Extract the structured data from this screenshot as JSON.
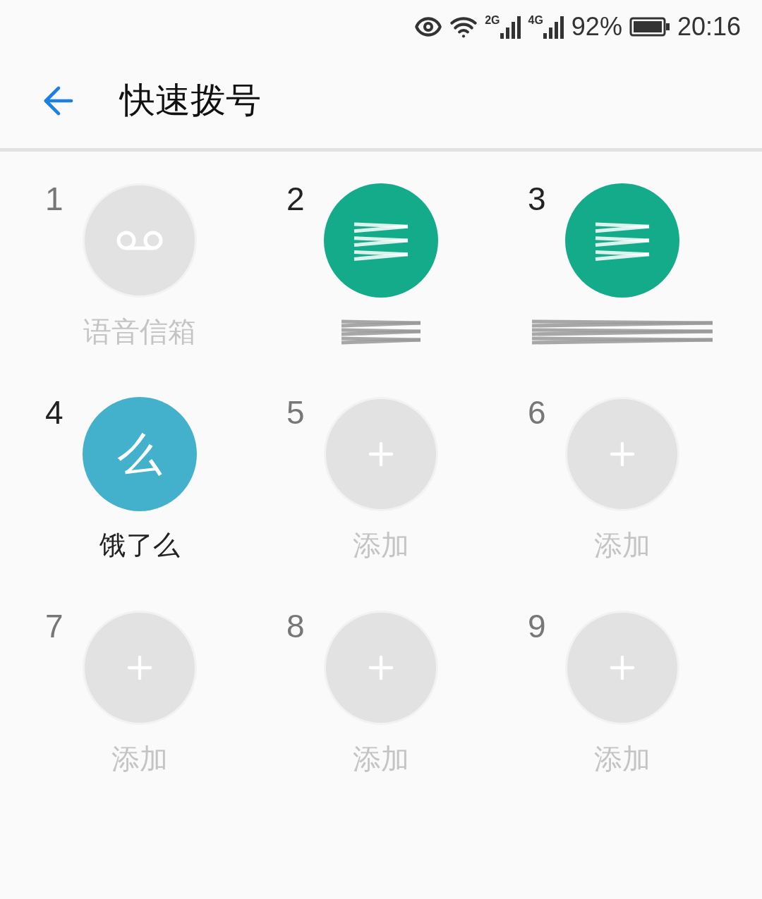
{
  "status_bar": {
    "network_1": "2G",
    "network_2": "4G",
    "battery": "92%",
    "time": "20:16"
  },
  "header": {
    "title": "快速拨号"
  },
  "slots": [
    {
      "number": "1",
      "kind": "voicemail",
      "label": "语音信箱"
    },
    {
      "number": "2",
      "kind": "redacted",
      "color": "#14ab8a"
    },
    {
      "number": "3",
      "kind": "redacted",
      "color": "#14ab8a"
    },
    {
      "number": "4",
      "kind": "contact",
      "color": "#44b1cc",
      "initial": "么",
      "label": "饿了么"
    },
    {
      "number": "5",
      "kind": "add",
      "label": "添加"
    },
    {
      "number": "6",
      "kind": "add",
      "label": "添加"
    },
    {
      "number": "7",
      "kind": "add",
      "label": "添加"
    },
    {
      "number": "8",
      "kind": "add",
      "label": "添加"
    },
    {
      "number": "9",
      "kind": "add",
      "label": "添加"
    }
  ]
}
